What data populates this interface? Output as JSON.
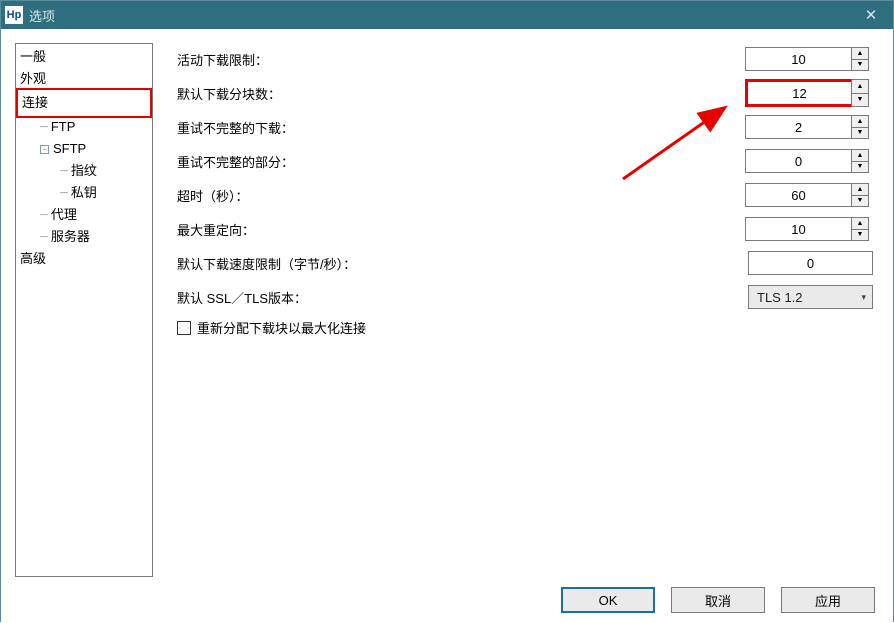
{
  "window": {
    "title": "选项"
  },
  "tree": {
    "general": "一般",
    "appearance": "外观",
    "connection": "连接",
    "ftp": "FTP",
    "sftp": "SFTP",
    "fingerprint": "指纹",
    "privatekey": "私钥",
    "proxy": "代理",
    "servers": "服务器",
    "advanced": "高级"
  },
  "labels": {
    "active_download_limit": "活动下载限制：",
    "default_segments": "默认下载分块数：",
    "retry_incomplete_download": "重试不完整的下载：",
    "retry_incomplete_part": "重试不完整的部分：",
    "timeout_seconds": "超时（秒）：",
    "max_redirects": "最大重定向：",
    "default_speed_limit": "默认下载速度限制（字节/秒）：",
    "default_ssl_version": "默认 SSL／TLS版本：",
    "reassign_blocks": "重新分配下载块以最大化连接"
  },
  "values": {
    "active_download_limit": "10",
    "default_segments": "12",
    "retry_incomplete_download": "2",
    "retry_incomplete_part": "0",
    "timeout_seconds": "60",
    "max_redirects": "10",
    "default_speed_limit": "0",
    "default_ssl_version": "TLS 1.2"
  },
  "buttons": {
    "ok": "OK",
    "cancel": "取消",
    "apply": "应用"
  }
}
